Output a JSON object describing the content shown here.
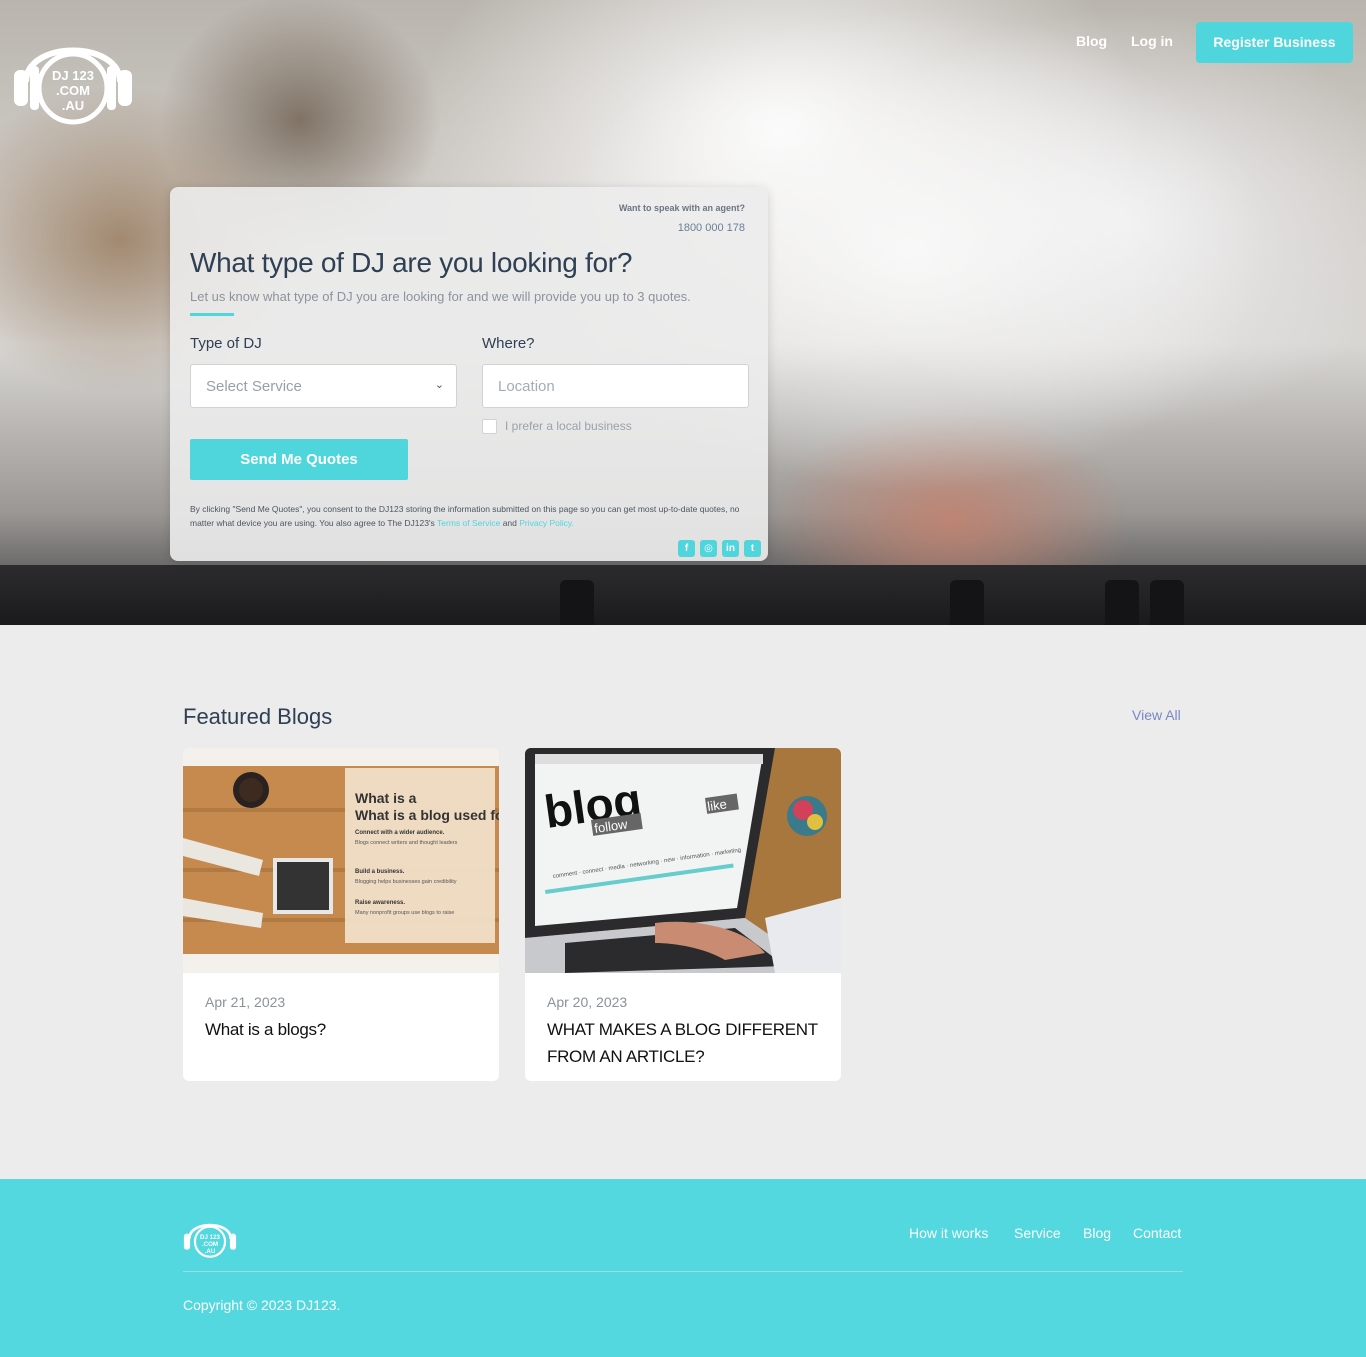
{
  "header": {
    "logo_text_1": "DJ 123",
    "logo_text_2": ".COM",
    "logo_text_3": ".AU",
    "nav": {
      "blog": "Blog",
      "login": "Log in",
      "register": "Register Business"
    }
  },
  "quote_form": {
    "agent_question": "Want to speak with an agent?",
    "agent_phone": "1800 000 178",
    "title": "What type of DJ are you looking for?",
    "subtitle": "Let us know what type of DJ you are looking for and we will provide you up to 3 quotes.",
    "type_label": "Type of DJ",
    "type_select_value": "Select Service",
    "where_label": "Where?",
    "location_placeholder": "Location",
    "local_checkbox_label": "I prefer a local business",
    "submit_label": "Send Me Quotes",
    "consent_text": "By clicking \"Send Me Quotes\", you consent to the DJ123 storing the information submitted on this page so you can get most up-to-date quotes, no matter what device you are using. You also agree to The DJ123's",
    "terms_link": "Terms of Service",
    "and_text": "and",
    "privacy_link": "Privacy Policy.",
    "socials": [
      {
        "name": "facebook-icon",
        "glyph": "f"
      },
      {
        "name": "instagram-icon",
        "glyph": "◎"
      },
      {
        "name": "linkedin-icon",
        "glyph": "in"
      },
      {
        "name": "twitter-icon",
        "glyph": "t"
      }
    ]
  },
  "featured": {
    "title": "Featured Blogs",
    "view_all": "View All",
    "posts": [
      {
        "date": "Apr 21, 2023",
        "title": "What is a blogs?",
        "image_text": {
          "heading": "What is a blog used for?",
          "items": [
            {
              "head": "Connect with a wider audience.",
              "body": "Blogs connect writers and thought leaders with an online audience passionate about the same subjects."
            },
            {
              "head": "Build a business.",
              "body": "Blogging helps businesses gain credibility and improve search engine rankings."
            },
            {
              "head": "Raise awareness.",
              "body": "Many nonprofit groups use blogs to raise awareness about their cause and influence public opinion."
            }
          ]
        }
      },
      {
        "date": "Apr 20, 2023",
        "title": "WHAT MAKES A BLOG DIFFERENT FROM AN ARTICLE?",
        "image_text": {
          "word": "blog",
          "sub1": "follow",
          "sub2": "like",
          "tags": "comment · connect · media · networking · new · information · marketing"
        }
      }
    ]
  },
  "footer": {
    "links": [
      "How it works",
      "Service",
      "Blog",
      "Contact"
    ],
    "copyright": "Copyright © 2023 DJ123."
  },
  "colors": {
    "accent": "#4fd6dd",
    "footer_bg": "#52d8de",
    "page_bg": "#ececec",
    "title": "#2f4054"
  }
}
